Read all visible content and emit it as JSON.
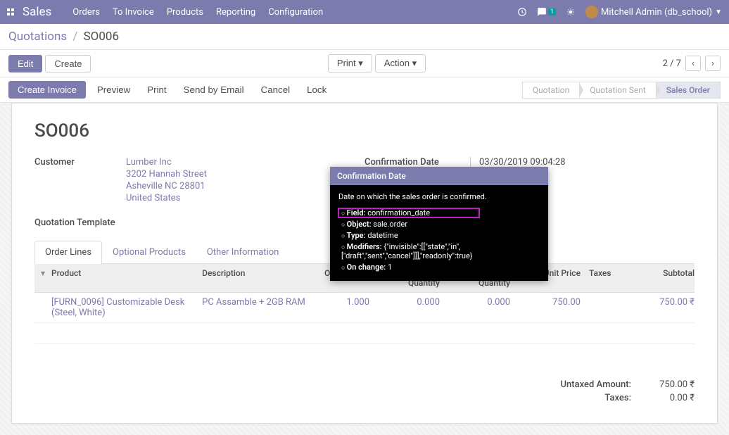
{
  "topbar": {
    "brand": "Sales",
    "nav": [
      "Orders",
      "To Invoice",
      "Products",
      "Reporting",
      "Configuration"
    ],
    "msg_badge": "1",
    "user": "Mitchell Admin (db_school)"
  },
  "breadcrumb": {
    "root": "Quotations",
    "sep": "/",
    "current": "SO006"
  },
  "toolbar": {
    "edit": "Edit",
    "create": "Create",
    "print": "Print",
    "action": "Action",
    "pager": "2 / 7"
  },
  "actions": {
    "create_invoice": "Create Invoice",
    "preview": "Preview",
    "print": "Print",
    "send_email": "Send by Email",
    "cancel": "Cancel",
    "lock": "Lock"
  },
  "status": {
    "s1": "Quotation",
    "s2": "Quotation Sent",
    "s3": "Sales Order"
  },
  "order": {
    "name": "SO006",
    "labels": {
      "customer": "Customer",
      "conf_date": "Confirmation Date",
      "quote_tmpl": "Quotation Template"
    },
    "customer": {
      "name": "Lumber Inc",
      "street": "3202 Hannah Street",
      "city": "Asheville NC 28801",
      "country": "United States"
    },
    "conf_date": "03/30/2019 09:04:28"
  },
  "tooltip": {
    "title": "Confirmation Date",
    "desc": "Date on which the sales order is confirmed.",
    "field_l": "Field:",
    "field_v": "confirmation_date",
    "object_l": "Object:",
    "object_v": "sale.order",
    "type_l": "Type:",
    "type_v": "datetime",
    "mod_l": "Modifiers:",
    "mod_v": "{\"invisible\":[[\"state\",\"in\",[\"draft\",\"sent\",\"cancel\"]]],\"readonly\":true}",
    "onchg_l": "On change:",
    "onchg_v": "1"
  },
  "tabs": {
    "t1": "Order Lines",
    "t2": "Optional Products",
    "t3": "Other Information"
  },
  "grid": {
    "headers": {
      "product": "Product",
      "desc": "Description",
      "ordqty": "Ordered Qty",
      "delqty": "Delivered Quantity",
      "invqty": "Invoiced Quantity",
      "price": "Unit Price",
      "taxes": "Taxes",
      "subtotal": "Subtotal"
    },
    "row": {
      "product": "[FURN_0096] Customizable Desk (Steel, White)",
      "desc": "PC Assamble + 2GB RAM",
      "ordqty": "1.000",
      "delqty": "0.000",
      "invqty": "0.000",
      "price": "750.00",
      "subtotal": "750.00 ₹"
    }
  },
  "totals": {
    "untaxed_l": "Untaxed Amount:",
    "untaxed_v": "750.00 ₹",
    "taxes_l": "Taxes:",
    "taxes_v": "0.00 ₹"
  }
}
